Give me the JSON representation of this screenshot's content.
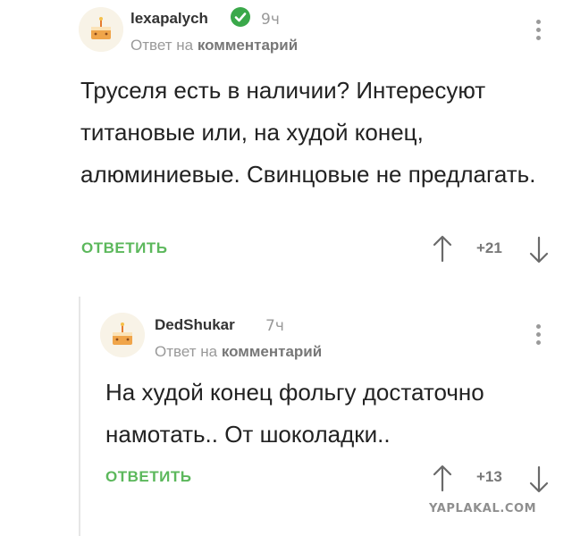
{
  "comments": [
    {
      "username": "lexapalych",
      "verified": true,
      "time": "9ч",
      "reply_prefix": "Ответ на",
      "reply_link": "комментарий",
      "body": "Труселя есть в наличии? Интересуют титановые или, на худой конец, алюминиевые. Свинцовые не предлагать.",
      "reply_label": "ОТВЕТИТЬ",
      "score": "+21",
      "accent": "#5cb85c"
    },
    {
      "username": "DedShukar",
      "verified": false,
      "time": "7ч",
      "reply_prefix": "Ответ на",
      "reply_link": "комментарий",
      "body": "На худой конец фольгу достаточно намотать.. От шоколадки..",
      "reply_label": "ОТВЕТИТЬ",
      "score": "+13",
      "accent": "#5cb85c"
    }
  ],
  "watermark": "YAPLAKAL.COM",
  "icons": {
    "avatar": "cake-avatar-icon",
    "verified": "checkmark-icon",
    "more": "more-vertical-icon",
    "upvote": "arrow-up-icon",
    "downvote": "arrow-down-icon"
  }
}
